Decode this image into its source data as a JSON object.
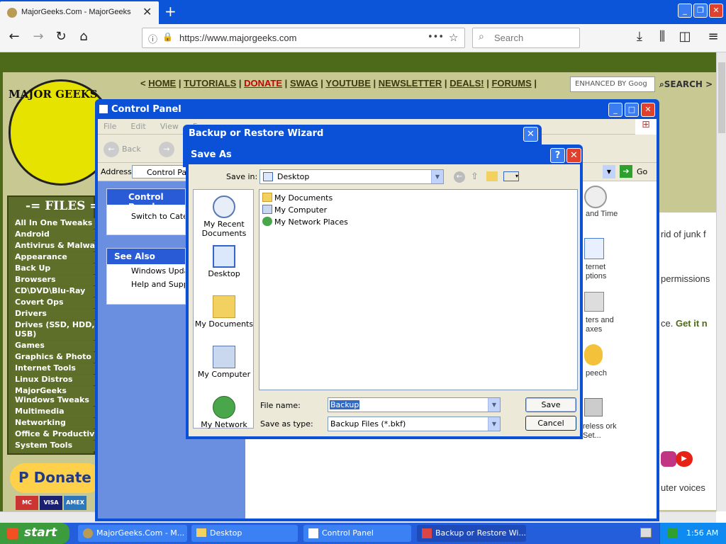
{
  "browser": {
    "tab_title": "MajorGeeks.Com - MajorGeeks",
    "tab_close": "✕",
    "new_tab": "+",
    "url": "https://www.majorgeeks.com",
    "page_actions": "•••",
    "search_placeholder": "Search"
  },
  "site": {
    "logo": "MAJOR GEEKS",
    "nav": {
      "lt": "<",
      "home": "HOME",
      "tutorials": "TUTORIALS",
      "donate": "DONATE",
      "swag": "SWAG",
      "youtube": "YOUTUBE",
      "newsletter": "NEWSLETTER",
      "deals": "DEALS!",
      "forums": "FORUMS",
      "gt": ">"
    },
    "search_box": "ENHANCED BY Goog",
    "search_button": "SEARCH",
    "files_title": "-= FILES =",
    "files": [
      "All In One Tweaks",
      "Android",
      "Antivirus & Malware",
      "Appearance",
      "Back Up",
      "Browsers",
      "CD\\DVD\\Blu-Ray",
      "Covert Ops",
      "Drivers",
      "Drives (SSD, HDD, USB)",
      "Games",
      "Graphics & Photo",
      "Internet Tools",
      "Linux Distros",
      "MajorGeeks Windows Tweaks",
      "Multimedia",
      "Networking",
      "Office & Productivity",
      "System Tools"
    ],
    "donate": "Donate",
    "cards": [
      "MC",
      "VISA",
      "AMEX"
    ],
    "right_texts": [
      "rid of junk f",
      "permissions",
      "ce.",
      "Get it n",
      "uter voices"
    ]
  },
  "control_panel": {
    "title": "Control Panel",
    "menu": [
      "File",
      "Edit",
      "View",
      "Fa"
    ],
    "back": "Back",
    "address_label": "Address",
    "address_value": "Control Pan",
    "go": "Go",
    "panel_title": "Control Panel",
    "switch": "Switch to Categ",
    "see_also": "See Also",
    "links": [
      "Windows Updat",
      "Help and Suppo"
    ],
    "icons": [
      "and Time",
      "ternet ptions",
      "ters and axes",
      "peech",
      "reless ork Set..."
    ]
  },
  "wizard": {
    "title": "Backup or Restore Wizard",
    "close": "✕"
  },
  "save_as": {
    "title": "Save As",
    "help": "?",
    "close": "✕",
    "save_in_label": "Save in:",
    "save_in_value": "Desktop",
    "places": [
      "My Recent Documents",
      "Desktop",
      "My Documents",
      "My Computer",
      "My Network"
    ],
    "files": [
      "My Documents",
      "My Computer",
      "My Network Places"
    ],
    "filename_label": "File name:",
    "filename_value": "Backup",
    "filetype_label": "Save as type:",
    "filetype_value": "Backup Files (*.bkf)",
    "save_btn": "Save",
    "cancel_btn": "Cancel"
  },
  "taskbar": {
    "start": "start",
    "buttons": [
      "MajorGeeks.Com - M...",
      "Desktop",
      "Control Panel",
      "Backup or Restore Wi..."
    ],
    "clock": "1:56 AM"
  }
}
